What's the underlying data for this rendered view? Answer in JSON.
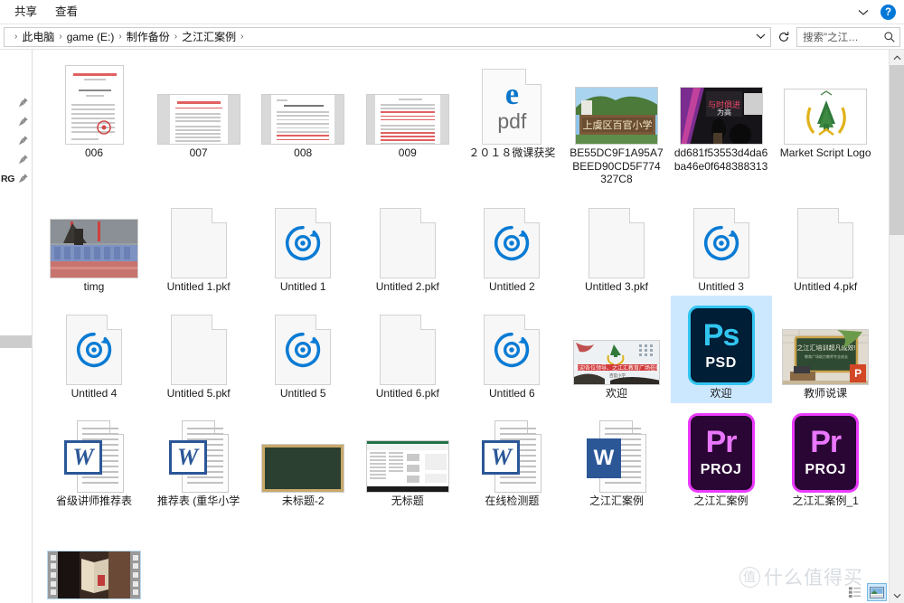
{
  "window": {
    "ribbon_tabs": [
      {
        "label": "共享",
        "name": "tab-share"
      },
      {
        "label": "查看",
        "name": "tab-view"
      }
    ],
    "help_label": "?",
    "expand_ribbon_label": "⌄"
  },
  "address_bar": {
    "separator": "›",
    "crumbs": [
      "此电脑",
      "game (E:)",
      "制作备份",
      "之江汇案例"
    ],
    "dropdown_label": "⌄",
    "refresh_label": "↻",
    "search_placeholder": "搜索\"之江…"
  },
  "nav_pane": {
    "pin_count": 5,
    "rg_label": "RG"
  },
  "files": [
    {
      "name": "006",
      "kind": "doc-thumb-red",
      "selected": false
    },
    {
      "name": "007",
      "kind": "doc-thumb-red2",
      "selected": false
    },
    {
      "name": "008",
      "kind": "doc-thumb-table",
      "selected": false
    },
    {
      "name": "009",
      "kind": "doc-thumb-table2",
      "selected": false
    },
    {
      "name": "２０１８微课获奖",
      "kind": "pdf",
      "selected": false
    },
    {
      "name": "BE55DC9F1A95A7BEED90CD5F774327C8",
      "kind": "photo-school",
      "selected": false
    },
    {
      "name": "dd681f53553d4da6ba46e0f648388313",
      "kind": "photo-stage",
      "selected": false
    },
    {
      "name": "Market Script Logo",
      "kind": "photo-logo",
      "selected": false
    },
    {
      "name": "timg",
      "kind": "photo-crowd",
      "selected": false
    },
    {
      "name": "Untitled 1.pkf",
      "kind": "pkf",
      "selected": false
    },
    {
      "name": "Untitled 1",
      "kind": "media",
      "selected": false
    },
    {
      "name": "Untitled 2.pkf",
      "kind": "pkf",
      "selected": false
    },
    {
      "name": "Untitled 2",
      "kind": "media",
      "selected": false
    },
    {
      "name": "Untitled 3.pkf",
      "kind": "pkf",
      "selected": false
    },
    {
      "name": "Untitled 3",
      "kind": "media",
      "selected": false
    },
    {
      "name": "Untitled 4.pkf",
      "kind": "pkf",
      "selected": false
    },
    {
      "name": "Untitled 4",
      "kind": "media",
      "selected": false
    },
    {
      "name": "Untitled 5.pkf",
      "kind": "pkf",
      "selected": false
    },
    {
      "name": "Untitled 5",
      "kind": "media",
      "selected": false
    },
    {
      "name": "Untitled 6.pkf",
      "kind": "pkf",
      "selected": false
    },
    {
      "name": "Untitled 6",
      "kind": "media",
      "selected": false
    },
    {
      "name": "欢迎",
      "kind": "photo-banner",
      "selected": false
    },
    {
      "name": "欢迎",
      "kind": "psd",
      "selected": true
    },
    {
      "name": "教师说课",
      "kind": "photo-ppt",
      "selected": false
    },
    {
      "name": "省级讲师推荐表",
      "kind": "word",
      "selected": false
    },
    {
      "name": "推荐表 (重华小学",
      "kind": "word",
      "selected": false
    },
    {
      "name": "未标题-2",
      "kind": "photo-board",
      "selected": false
    },
    {
      "name": "无标题",
      "kind": "photo-excel",
      "selected": false
    },
    {
      "name": "在线检测题",
      "kind": "word",
      "selected": false
    },
    {
      "name": "之江汇案例",
      "kind": "word-flat",
      "selected": false
    },
    {
      "name": "之江汇案例",
      "kind": "prproj",
      "selected": false
    },
    {
      "name": "之江汇案例_1",
      "kind": "prproj",
      "selected": false
    },
    {
      "name": "",
      "kind": "video",
      "selected": false
    }
  ],
  "icon_text": {
    "pdf_e": "e",
    "pdf_label": "pdf",
    "psd_big": "Ps",
    "psd_small": "PSD",
    "prproj_big": "Pr",
    "prproj_small": "PROJ",
    "word_letter": "W"
  },
  "colors": {
    "selection": "#cce8ff",
    "accent": "#0078d7",
    "psd_bg": "#001e36",
    "psd_border": "#31c5f0",
    "psd_text": "#31c5f0",
    "prproj_bg": "#2a0634",
    "prproj_border": "#ea3afc",
    "prproj_text": "#ea77ff",
    "word_blue": "#2b5797",
    "edge_blue": "#0b75c9"
  },
  "scrollbar": {
    "up_arrow": "⌃",
    "down_arrow": "⌄"
  },
  "status": {
    "view_detail_icon": "details-view-icon",
    "view_thumbnail_icon": "thumbnail-view-icon"
  },
  "watermark": {
    "circle_char": "值",
    "text": "什么值得买"
  }
}
